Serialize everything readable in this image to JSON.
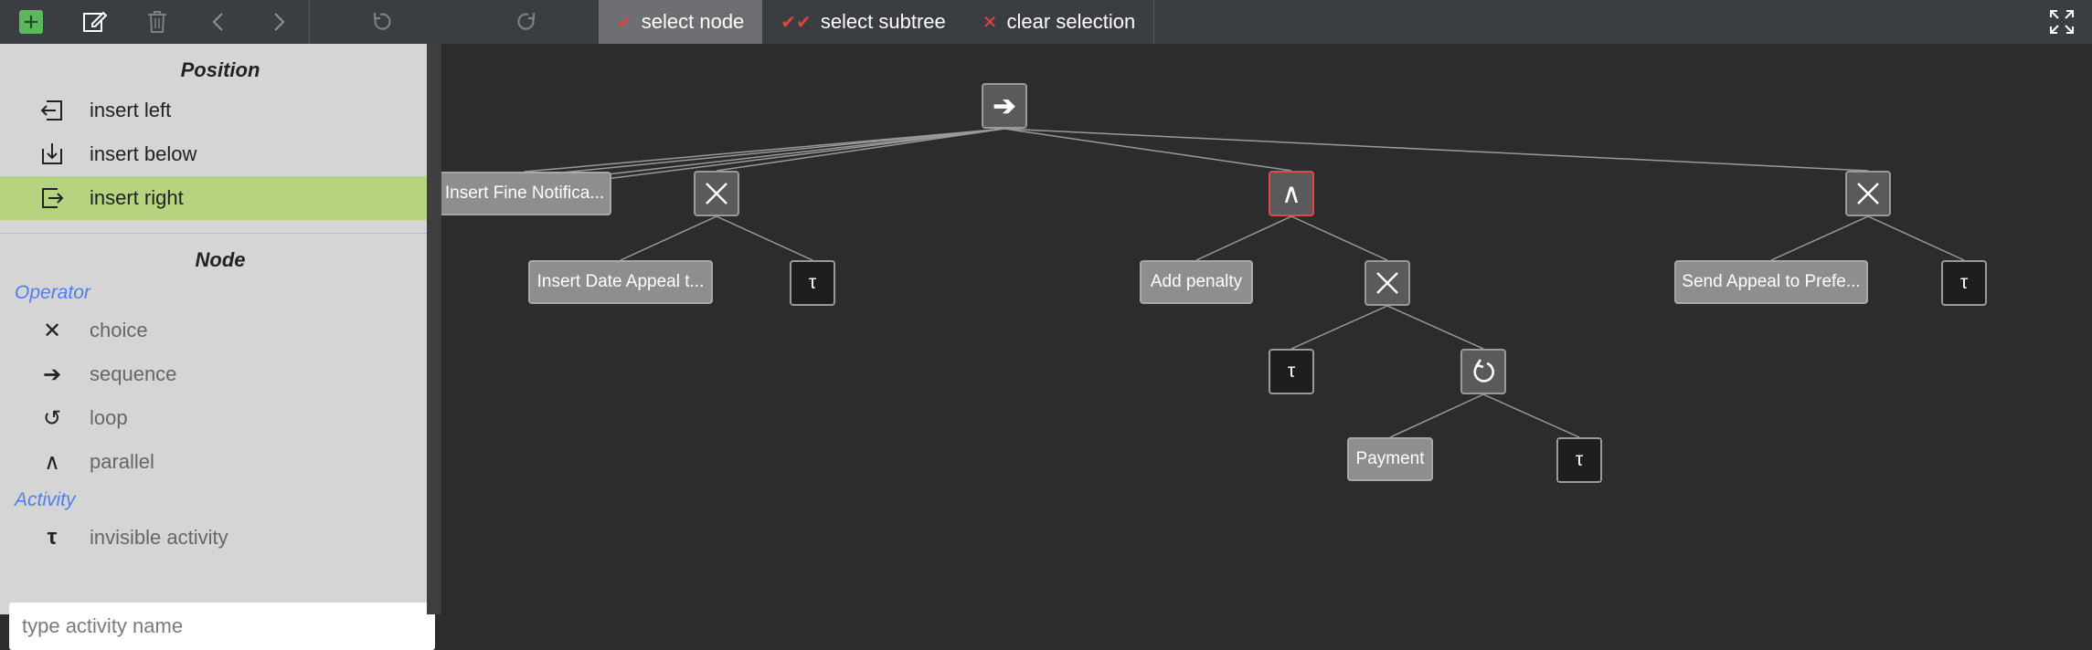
{
  "toolbar": {
    "buttons": [
      {
        "name": "add-button",
        "icon": "plus-icon"
      },
      {
        "name": "edit-button",
        "icon": "edit-icon"
      },
      {
        "name": "delete-button",
        "icon": "trash-icon"
      },
      {
        "name": "back-button",
        "icon": "chevron-left-icon"
      },
      {
        "name": "forward-button",
        "icon": "chevron-right-icon"
      },
      {
        "name": "undo-button",
        "icon": "undo-icon"
      },
      {
        "name": "redo-button",
        "icon": "redo-icon"
      }
    ],
    "select_node": "select node",
    "select_subtree": "select subtree",
    "clear_selection": "clear selection",
    "fullscreen_icon": "fullscreen-icon"
  },
  "panel": {
    "position_title": "Position",
    "positions": [
      {
        "label": "insert left",
        "icon": "insert-left-icon"
      },
      {
        "label": "insert below",
        "icon": "insert-below-icon"
      },
      {
        "label": "insert right",
        "icon": "insert-right-icon",
        "active": true
      }
    ],
    "node_title": "Node",
    "operator_label": "Operator",
    "operators": [
      {
        "symbol": "✕",
        "label": "choice"
      },
      {
        "symbol": "➔",
        "label": "sequence"
      },
      {
        "symbol": "↺",
        "label": "loop"
      },
      {
        "symbol": "∧",
        "label": "parallel"
      }
    ],
    "activity_label": "Activity",
    "activities": [
      {
        "symbol": "τ",
        "label": "invisible activity"
      }
    ],
    "input_placeholder": "type activity name"
  },
  "colors": {
    "accent_green": "#b6d37f",
    "selection_red": "#e24a4a",
    "category_blue": "#4f7df0"
  },
  "tree": {
    "nodes": {
      "root": {
        "kind": "operator",
        "symbol": "➔",
        "type": "sequence"
      },
      "act-fine": {
        "kind": "activity",
        "label": "Insert Fine Notifica..."
      },
      "xor1": {
        "kind": "operator",
        "symbol": "✕",
        "type": "choice"
      },
      "act-date": {
        "kind": "activity",
        "label": "Insert Date Appeal t..."
      },
      "tau1": {
        "kind": "tau",
        "label": "τ"
      },
      "and1": {
        "kind": "operator",
        "symbol": "∧",
        "type": "parallel",
        "selected": true
      },
      "act-penalty": {
        "kind": "activity",
        "label": "Add penalty"
      },
      "xor2": {
        "kind": "operator",
        "symbol": "✕",
        "type": "choice"
      },
      "tau2": {
        "kind": "tau",
        "label": "τ"
      },
      "loop1": {
        "kind": "operator",
        "symbol": "↺",
        "type": "loop"
      },
      "act-payment": {
        "kind": "activity",
        "label": "Payment"
      },
      "tau3": {
        "kind": "tau",
        "label": "τ"
      },
      "xor3": {
        "kind": "operator",
        "symbol": "✕",
        "type": "choice"
      },
      "act-appeal": {
        "kind": "activity",
        "label": "Send Appeal to Prefe..."
      },
      "tau4": {
        "kind": "tau",
        "label": "τ"
      }
    },
    "edges": [
      [
        "root",
        "act-fine"
      ],
      [
        "root",
        "xor1"
      ],
      [
        "root",
        "and1"
      ],
      [
        "root",
        "xor3"
      ],
      [
        "xor1",
        "act-date"
      ],
      [
        "xor1",
        "tau1"
      ],
      [
        "and1",
        "act-penalty"
      ],
      [
        "and1",
        "xor2"
      ],
      [
        "xor2",
        "tau2"
      ],
      [
        "xor2",
        "loop1"
      ],
      [
        "loop1",
        "act-payment"
      ],
      [
        "loop1",
        "tau3"
      ],
      [
        "xor3",
        "act-appeal"
      ],
      [
        "xor3",
        "tau4"
      ]
    ]
  }
}
